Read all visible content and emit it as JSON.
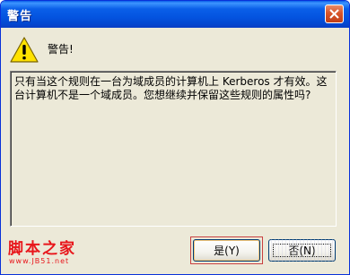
{
  "window": {
    "title": "警告"
  },
  "alert": {
    "label": "警告!",
    "message": "只有当这个规则在一台为域成员的计算机上 Kerberos 才有效。这台计算机不是一个域成员。您想继续并保留这些规则的属性吗?"
  },
  "buttons": {
    "yes_label": "是(Y)",
    "no_label": "否(N)"
  },
  "watermark": {
    "site_name": "脚本之家",
    "site_url": "www.JB51.net"
  },
  "colors": {
    "titlebar": "#0454e0",
    "close_button": "#d8552a",
    "dialog_background": "#ece9d8",
    "watermark": "#e8161b"
  }
}
